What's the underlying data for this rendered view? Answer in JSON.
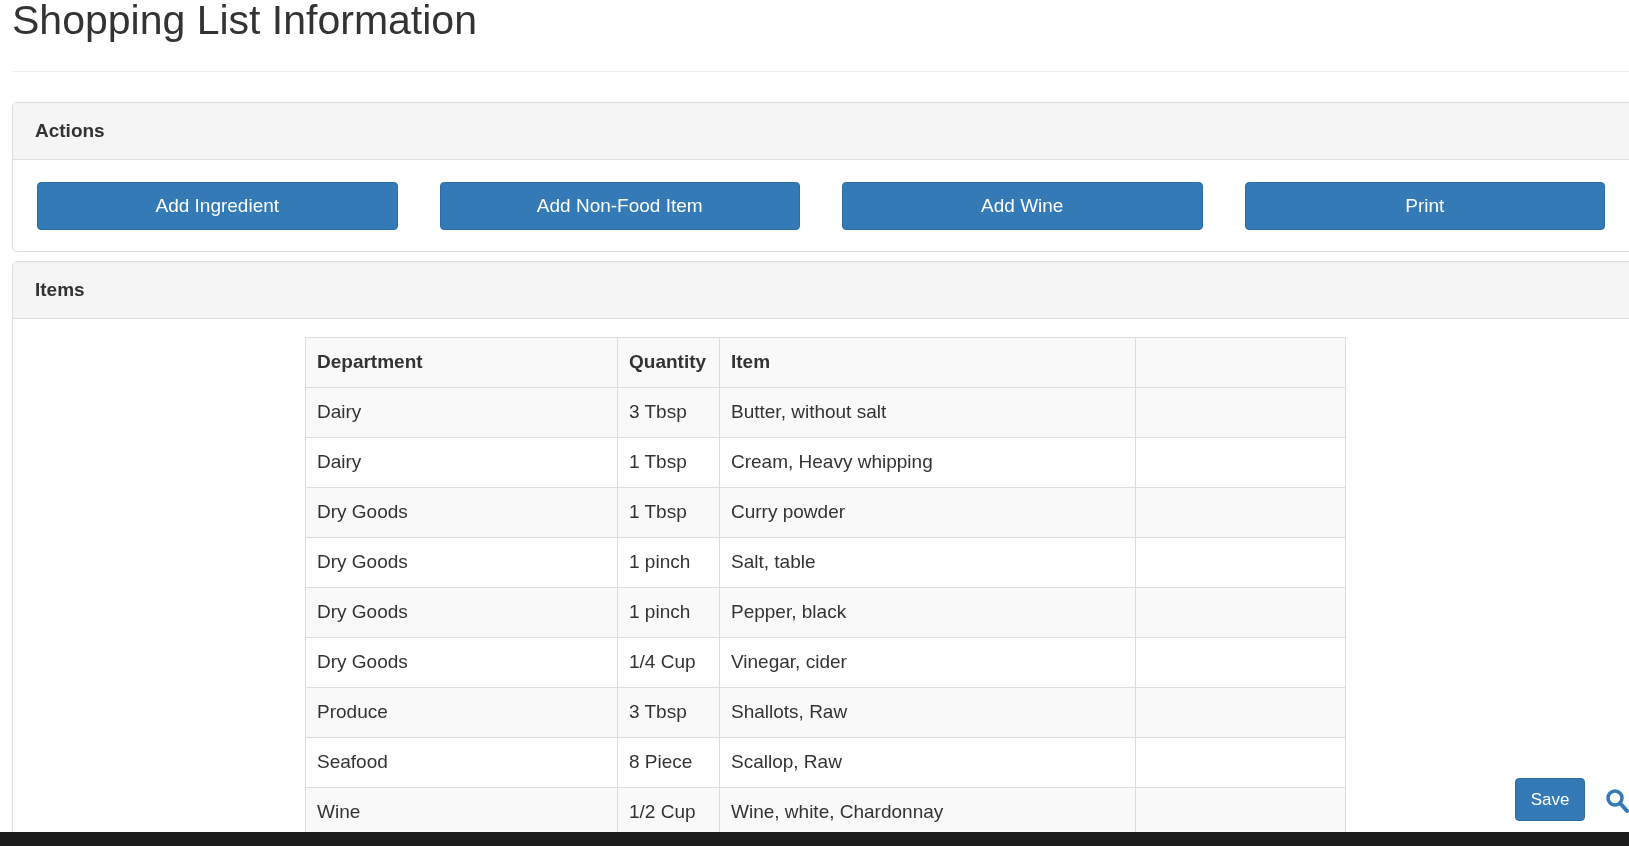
{
  "page_title": "Shopping List Information",
  "actions": {
    "title": "Actions",
    "buttons": [
      "Add Ingredient",
      "Add Non-Food Item",
      "Add Wine",
      "Print"
    ]
  },
  "items": {
    "title": "Items",
    "table": {
      "columns": [
        "Department",
        "Quantity",
        "Item"
      ],
      "rows": [
        {
          "department": "Dairy",
          "quantity": "3 Tbsp",
          "item": "Butter, without salt"
        },
        {
          "department": "Dairy",
          "quantity": "1 Tbsp",
          "item": "Cream, Heavy whipping"
        },
        {
          "department": "Dry Goods",
          "quantity": "1 Tbsp",
          "item": "Curry powder"
        },
        {
          "department": "Dry Goods",
          "quantity": "1 pinch",
          "item": "Salt, table"
        },
        {
          "department": "Dry Goods",
          "quantity": "1 pinch",
          "item": "Pepper, black"
        },
        {
          "department": "Dry Goods",
          "quantity": "1/4 Cup",
          "item": "Vinegar, cider"
        },
        {
          "department": "Produce",
          "quantity": "3 Tbsp",
          "item": "Shallots, Raw"
        },
        {
          "department": "Seafood",
          "quantity": "8 Piece",
          "item": "Scallop, Raw"
        },
        {
          "department": "Wine",
          "quantity": "1/2 Cup",
          "item": "Wine, white, Chardonnay"
        }
      ]
    }
  },
  "save_button": "Save"
}
